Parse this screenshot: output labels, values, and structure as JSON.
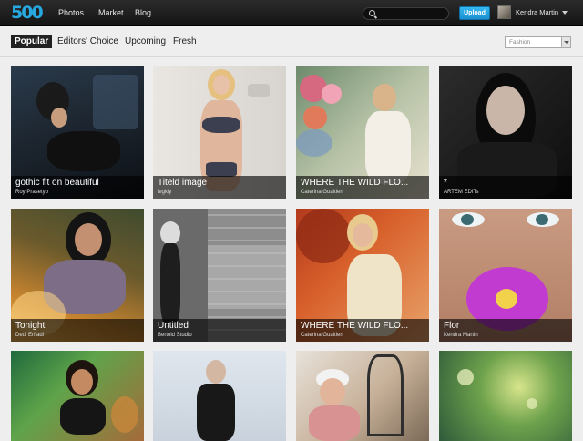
{
  "topbar": {
    "logo": "500",
    "nav": [
      "Photos",
      "Market",
      "Blog"
    ],
    "search_placeholder": "",
    "upload_label": "Upload",
    "user_name": "Kendra Martin"
  },
  "subnav": {
    "tabs": [
      "Popular",
      "Editors' Choice",
      "Upcoming",
      "Fresh"
    ],
    "active_tab": "Popular",
    "category_selected": "Fashion"
  },
  "photos": [
    {
      "title": "gothic fit on beautiful",
      "author": "Roy Prasetyo"
    },
    {
      "title": "Titeld image",
      "author": "legkiy"
    },
    {
      "title": "WHERE THE WILD FLO...",
      "author": "Caterina Gualtieri"
    },
    {
      "title": "*",
      "author": "ARTEM EDITs"
    },
    {
      "title": "Tonight",
      "author": "Dedi Erfiadi"
    },
    {
      "title": "Untitled",
      "author": "Bertold Studio"
    },
    {
      "title": "WHERE THE WILD FLO...",
      "author": "Caterina Gualtieri"
    },
    {
      "title": "Flor",
      "author": "Kendra Martin"
    },
    {
      "title": "",
      "author": ""
    },
    {
      "title": "",
      "author": ""
    },
    {
      "title": "",
      "author": ""
    },
    {
      "title": "",
      "author": ""
    }
  ],
  "colors": {
    "topbar_bg": "#1c1c1c",
    "accent_blue": "#27a8e0",
    "page_bg": "#eeeeee"
  }
}
